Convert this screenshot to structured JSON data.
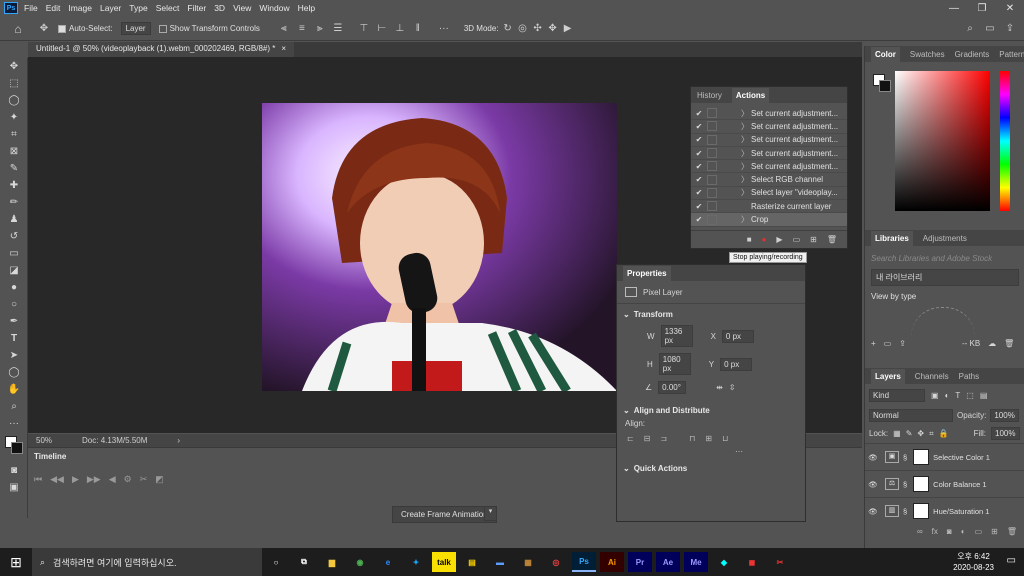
{
  "menubar": {
    "items": [
      "File",
      "Edit",
      "Image",
      "Layer",
      "Type",
      "Select",
      "Filter",
      "3D",
      "View",
      "Window",
      "Help"
    ]
  },
  "options": {
    "autoselect": "Auto-Select:",
    "layer_dd": "Layer",
    "transform": "Show Transform Controls",
    "mode3d": "3D Mode:"
  },
  "doc": {
    "tab": "Untitled-1 @ 50% (videoplayback (1).webm_000202469, RGB/8#) *",
    "close": "×"
  },
  "status": {
    "zoom": "50%",
    "doc": "Doc: 4.13M/5.50M"
  },
  "history": {
    "tabs": [
      "History",
      "Actions"
    ],
    "actions": [
      "Set current adjustment...",
      "Set current adjustment...",
      "Set current adjustment...",
      "Set current adjustment...",
      "Set current adjustment...",
      "Select RGB channel",
      "Select layer \"videoplay...",
      "Rasterize current layer",
      "Crop"
    ],
    "tooltip": "Stop playing/recording"
  },
  "props": {
    "title": "Properties",
    "pixel": "Pixel Layer",
    "transform": "Transform",
    "w_lbl": "W",
    "w": "1336 px",
    "x_lbl": "X",
    "x": "0 px",
    "h_lbl": "H",
    "h": "1080 px",
    "y_lbl": "Y",
    "y": "0 px",
    "angle": "0.00°",
    "align": "Align and Distribute",
    "align_lbl": "Align:",
    "quick": "Quick Actions"
  },
  "timeline": {
    "title": "Timeline",
    "create": "Create Frame Animation"
  },
  "color": {
    "tabs": [
      "Color",
      "Swatches",
      "Gradients",
      "Patterns"
    ]
  },
  "libraries": {
    "tabs": [
      "Libraries",
      "Adjustments"
    ],
    "search": "Search Libraries and Adobe Stock",
    "lib": "내 라이브러리",
    "view": "View by type",
    "kb": "-- KB"
  },
  "layers": {
    "tabs": [
      "Layers",
      "Channels",
      "Paths"
    ],
    "kind": "Kind",
    "blend": "Normal",
    "opacity_lbl": "Opacity:",
    "opacity": "100%",
    "lock": "Lock:",
    "fill_lbl": "Fill:",
    "fill": "100%",
    "items": [
      "Selective Color 1",
      "Color Balance 1",
      "Hue/Saturation 1"
    ]
  },
  "taskbar": {
    "search": "검색하려면 여기에 입력하십시오.",
    "time": "오후 6:42",
    "date": "2020-08-23",
    "apps": [
      "Ps",
      "Ai",
      "Pr",
      "Ae",
      "Me"
    ]
  }
}
